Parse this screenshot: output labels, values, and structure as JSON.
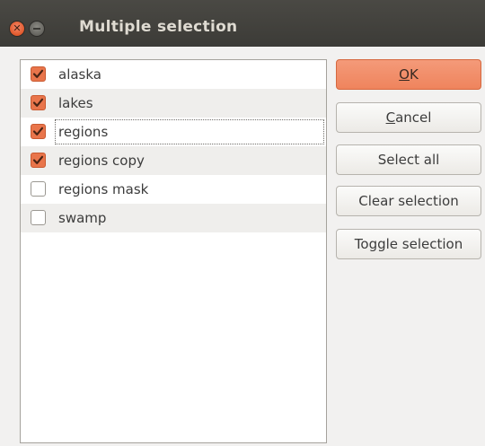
{
  "window": {
    "title": "Multiple selection"
  },
  "list": {
    "items": [
      {
        "label": "alaska",
        "checked": true
      },
      {
        "label": "lakes",
        "checked": true
      },
      {
        "label": "regions",
        "checked": true,
        "focused": true
      },
      {
        "label": "regions copy",
        "checked": true
      },
      {
        "label": "regions mask",
        "checked": false
      },
      {
        "label": "swamp",
        "checked": false
      }
    ]
  },
  "buttons": {
    "ok": {
      "mnemonic": "O",
      "rest": "K"
    },
    "cancel": {
      "mnemonic": "C",
      "rest": "ancel"
    },
    "select_all": "Select all",
    "clear_selection": "Clear selection",
    "toggle_selection": "Toggle selection"
  },
  "colors": {
    "accent": "#e9754b",
    "titlebar": "#3c3b37",
    "background": "#f2f1f0"
  },
  "icons": {
    "close": "close-icon",
    "minimize": "minimize-icon",
    "check": "checkmark-icon"
  }
}
